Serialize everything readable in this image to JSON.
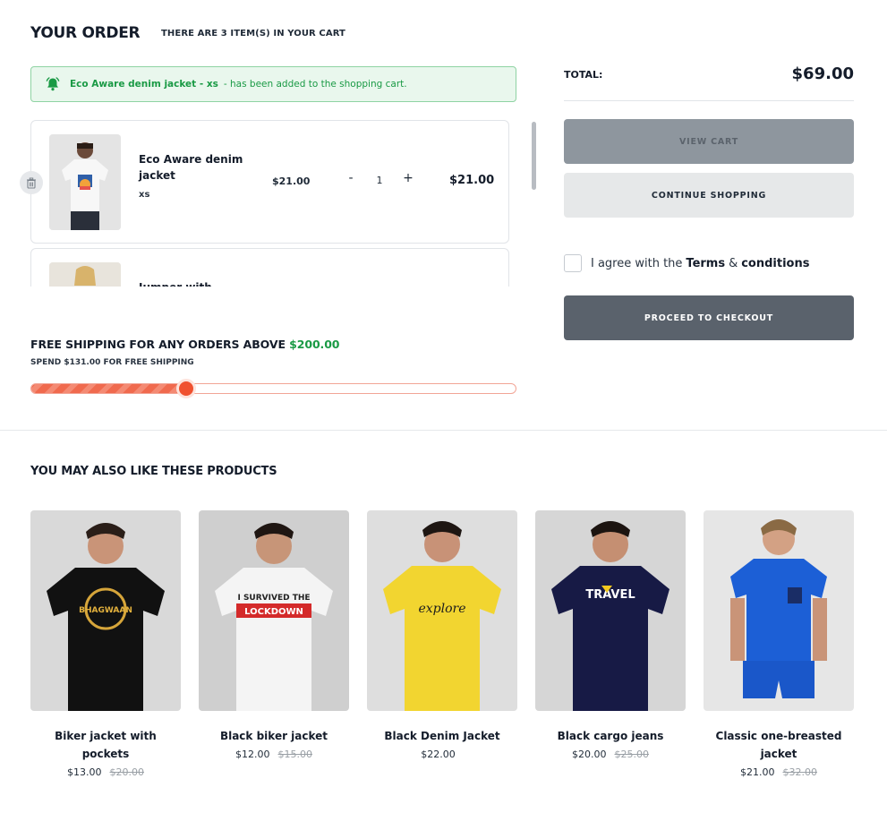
{
  "header": {
    "title": "YOUR ORDER",
    "count_text": "THERE ARE 3 ITEM(S) IN YOUR CART"
  },
  "alert": {
    "product": "Eco Aware denim jacket - xs",
    "message": "- has been added to the shopping cart.",
    "icon": "bell-icon",
    "color": "#1a9a45"
  },
  "cart_items": [
    {
      "name": "Eco Aware denim jacket",
      "variant": "xs",
      "price": "$21.00",
      "quantity": "1",
      "total": "$21.00",
      "minus": "-",
      "plus": "+"
    },
    {
      "name": "Jumper with"
    }
  ],
  "shipping": {
    "title": "FREE SHIPPING FOR ANY ORDERS ABOVE",
    "threshold": "$200.00",
    "subtitle": "SPEND $131.00 FOR FREE SHIPPING",
    "progress_fraction": 0.32
  },
  "summary": {
    "total_label": "TOTAL:",
    "total_value": "$69.00",
    "view_cart": "VIEW CART",
    "continue_shopping": "CONTINUE SHOPPING",
    "agree_prefix": "I agree with the",
    "terms": "Terms",
    "amp": "&",
    "conditions": "conditions",
    "checkout": "PROCEED TO CHECKOUT"
  },
  "recommendations": {
    "title": "YOU MAY ALSO LIKE THESE PRODUCTS",
    "products": [
      {
        "name": "Biker jacket with pockets",
        "price": "$13.00",
        "old_price": "$20.00",
        "shirt_color": "#111111",
        "print": "BHAGWAAN"
      },
      {
        "name": "Black biker jacket",
        "price": "$12.00",
        "old_price": "$15.00",
        "shirt_color": "#f4f4f4",
        "print": "I SURVIVED THE LOCKDOWN"
      },
      {
        "name": "Black Denim Jacket",
        "price": "$22.00",
        "shirt_color": "#f2d530",
        "print": "explore"
      },
      {
        "name": "Black cargo jeans",
        "price": "$20.00",
        "old_price": "$25.00",
        "shirt_color": "#171a45",
        "print": "TRAVEL"
      },
      {
        "name": "Classic one-breasted jacket",
        "price": "$21.00",
        "old_price": "$32.00",
        "shirt_color": "#1c5fd6",
        "print": ""
      }
    ]
  },
  "colors": {
    "accent_green": "#1a9a45",
    "progress_orange": "#f0512f",
    "checkout_button": "#5a626c"
  }
}
